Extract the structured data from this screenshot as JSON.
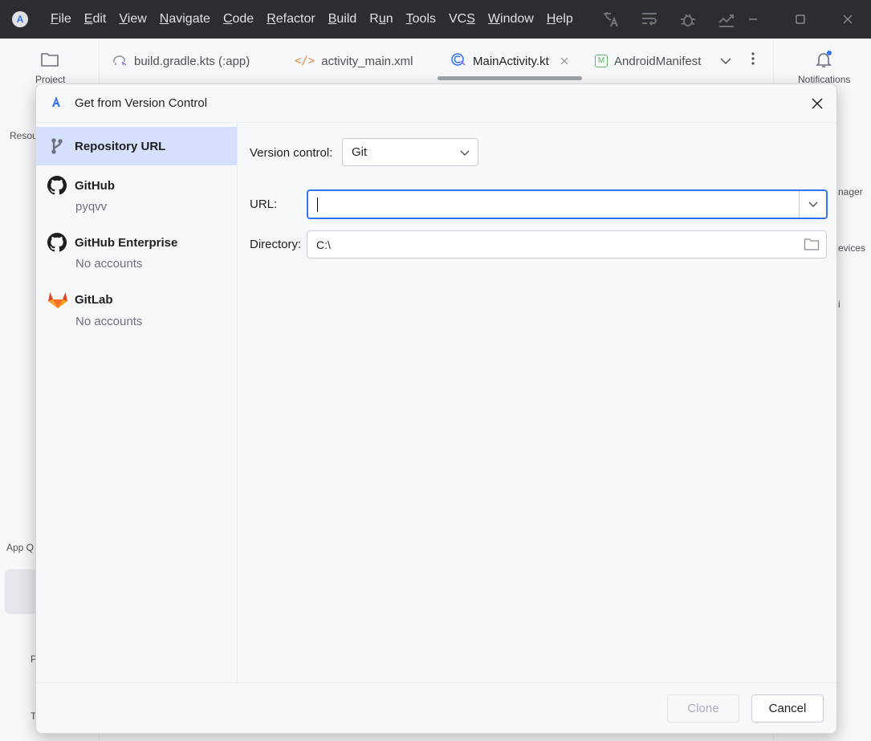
{
  "menu": {
    "items": [
      {
        "pre": "",
        "u": "F",
        "post": "ile"
      },
      {
        "pre": "",
        "u": "E",
        "post": "dit"
      },
      {
        "pre": "",
        "u": "V",
        "post": "iew"
      },
      {
        "pre": "",
        "u": "N",
        "post": "avigate"
      },
      {
        "pre": "",
        "u": "C",
        "post": "ode"
      },
      {
        "pre": "",
        "u": "R",
        "post": "efactor"
      },
      {
        "pre": "",
        "u": "B",
        "post": "uild"
      },
      {
        "pre": "R",
        "u": "u",
        "post": "n"
      },
      {
        "pre": "",
        "u": "T",
        "post": "ools"
      },
      {
        "pre": "VC",
        "u": "S",
        "post": ""
      },
      {
        "pre": "",
        "u": "W",
        "post": "indow"
      },
      {
        "pre": "",
        "u": "H",
        "post": "elp"
      }
    ]
  },
  "left_strip": {
    "project": "Project",
    "resource": "Resou",
    "app_q": "App Q",
    "p": "P",
    "t": "T"
  },
  "right_strip": {
    "notifications": "Notifications",
    "manager": "nager",
    "devices": "evices",
    "i": "i"
  },
  "tabs": [
    {
      "label": "build.gradle.kts (:app)"
    },
    {
      "label": "activity_main.xml"
    },
    {
      "label": "MainActivity.kt"
    },
    {
      "label": "AndroidManifest"
    }
  ],
  "dialog": {
    "title": "Get from Version Control",
    "sources": [
      {
        "name": "Repository URL",
        "sub": ""
      },
      {
        "name": "GitHub",
        "sub": "pyqvv"
      },
      {
        "name": "GitHub Enterprise",
        "sub": "No accounts"
      },
      {
        "name": "GitLab",
        "sub": "No accounts"
      }
    ],
    "version_control_label": "Version control:",
    "version_control_value": "Git",
    "url_label": "URL:",
    "url_value": "",
    "directory_label": "Directory:",
    "directory_value": "C:\\",
    "clone_label": "Clone",
    "cancel_label": "Cancel"
  },
  "colors": {
    "accent": "#3574f0",
    "selected": "#d5e1fc",
    "gitlab": "#e24329",
    "titlebar": "#2b2d30"
  }
}
